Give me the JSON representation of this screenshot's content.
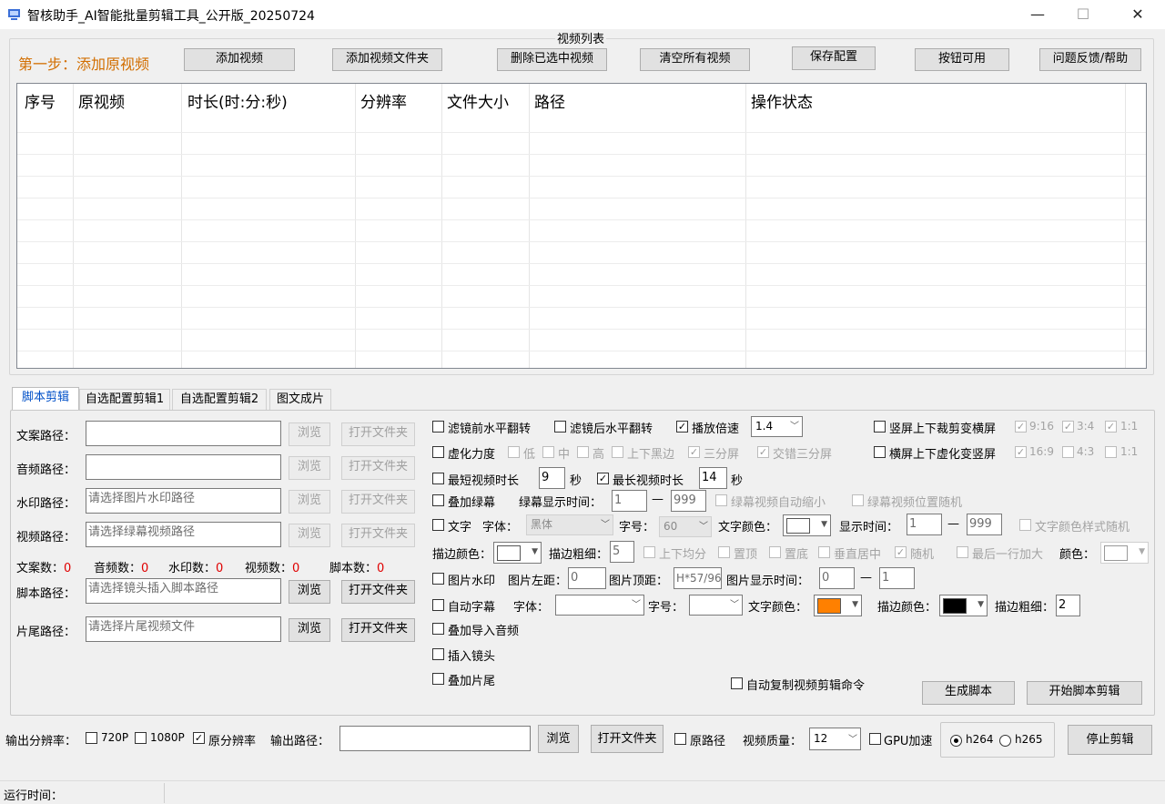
{
  "window": {
    "title": "智核助手_AI智能批量剪辑工具_公开版_20250724",
    "minimize": "—",
    "maximize": "☐",
    "close": "✕"
  },
  "top": {
    "group_title": "视频列表",
    "step_label": "第一步：添加原视频",
    "buttons": [
      "添加视频",
      "添加视频文件夹",
      "删除已选中视频",
      "清空所有视频",
      "保存配置",
      "按钮可用",
      "问题反馈/帮助"
    ],
    "step_color": "#d26e00"
  },
  "list": {
    "columns": [
      "序号",
      "原视频",
      "时长(时:分:秒)",
      "分辨率",
      "文件大小",
      "路径",
      "操作状态"
    ]
  },
  "tabs": [
    "脚本剪辑",
    "自选配置剪辑1",
    "自选配置剪辑2",
    "图文成片"
  ],
  "left": {
    "paths": [
      {
        "label": "文案路径：",
        "placeholder": "",
        "browse": "浏览",
        "open": "打开文件夹"
      },
      {
        "label": "音频路径：",
        "placeholder": "",
        "browse": "浏览",
        "open": "打开文件夹"
      },
      {
        "label": "水印路径：",
        "placeholder": "请选择图片水印路径",
        "browse": "浏览",
        "open": "打开文件夹"
      },
      {
        "label": "视频路径：",
        "placeholder": "请选择绿幕视频路径",
        "browse": "浏览",
        "open": "打开文件夹"
      }
    ],
    "counts": [
      {
        "label": "文案数：",
        "value": "0"
      },
      {
        "label": "音频数：",
        "value": "0"
      },
      {
        "label": "水印数：",
        "value": "0"
      },
      {
        "label": "视频数：",
        "value": "0"
      },
      {
        "label": "脚本数：",
        "value": "0"
      }
    ],
    "script": {
      "label": "脚本路径：",
      "placeholder": "请选择镜头插入脚本路径",
      "browse": "浏览",
      "open": "打开文件夹"
    },
    "tail": {
      "label": "片尾路径：",
      "placeholder": "请选择片尾视频文件",
      "browse": "浏览",
      "open": "打开文件夹"
    }
  },
  "opts": {
    "flip_before": "滤镜前水平翻转",
    "flip_after": "滤镜后水平翻转",
    "speed": {
      "label": "播放倍速",
      "value": "1.4"
    },
    "v_to_h": "竖屏上下裁剪变横屏",
    "v_ratios": [
      "9:16",
      "3:4",
      "1:1"
    ],
    "blur": {
      "label": "虚化力度",
      "levels": [
        "低",
        "中",
        "高",
        "上下黑边",
        "三分屏",
        "交错三分屏"
      ]
    },
    "h_to_v": "横屏上下虚化变竖屏",
    "h_ratios": [
      "16:9",
      "4:3",
      "1:1"
    ],
    "min_len": {
      "label": "最短视频时长",
      "value": "9",
      "unit": "秒"
    },
    "max_len": {
      "label": "最长视频时长",
      "value": "14",
      "unit": "秒"
    },
    "green": {
      "label": "叠加绿幕",
      "time_label": "绿幕显示时间：",
      "from": "1",
      "dash": "—",
      "to": "999",
      "shrink": "绿幕视频自动缩小",
      "random_pos": "绿幕视频位置随机"
    },
    "text": {
      "label": "文字",
      "font_label": "字体：",
      "font": "黑体",
      "size_label": "字号：",
      "size": "60",
      "color_label": "文字颜色：",
      "time_label": "显示时间：",
      "from": "1",
      "dash": "—",
      "to": "999",
      "random_style": "文字颜色样式随机"
    },
    "stroke": {
      "color_label": "描边颜色：",
      "width_label": "描边粗细：",
      "width": "5",
      "checks": [
        "上下均分",
        "置顶",
        "置底",
        "垂直居中",
        "随机",
        "最后一行加大"
      ],
      "color2_label": "颜色："
    },
    "img_wm": {
      "label": "图片水印",
      "left_label": "图片左距：",
      "left": "0",
      "top_label": "图片顶距：",
      "top": "H*57/96",
      "time_label": "图片显示时间：",
      "from": "0",
      "dash": "—",
      "to": "1"
    },
    "subtitle": {
      "label": "自动字幕",
      "font_label": "字体：",
      "size_label": "字号：",
      "color_label": "文字颜色：",
      "stroke_label": "描边颜色：",
      "width_label": "描边粗细：",
      "width": "2",
      "text_color": "#ff8000",
      "stroke_color": "#000000"
    },
    "audio": "叠加导入音频",
    "insert": "插入镜头",
    "tail": "叠加片尾",
    "auto_copy": "自动复制视频剪辑命令",
    "gen": "生成脚本",
    "start": "开始脚本剪辑"
  },
  "bottom": {
    "res_label": "输出分辨率：",
    "r720": "720P",
    "r1080": "1080P",
    "orig": "原分辨率",
    "out_label": "输出路径：",
    "browse": "浏览",
    "open": "打开文件夹",
    "orig_path": "原路径",
    "quality_label": "视频质量：",
    "quality": "12",
    "gpu": "GPU加速",
    "h264": "h264",
    "h265": "h265",
    "stop": "停止剪辑"
  },
  "status": {
    "label": "运行时间："
  }
}
